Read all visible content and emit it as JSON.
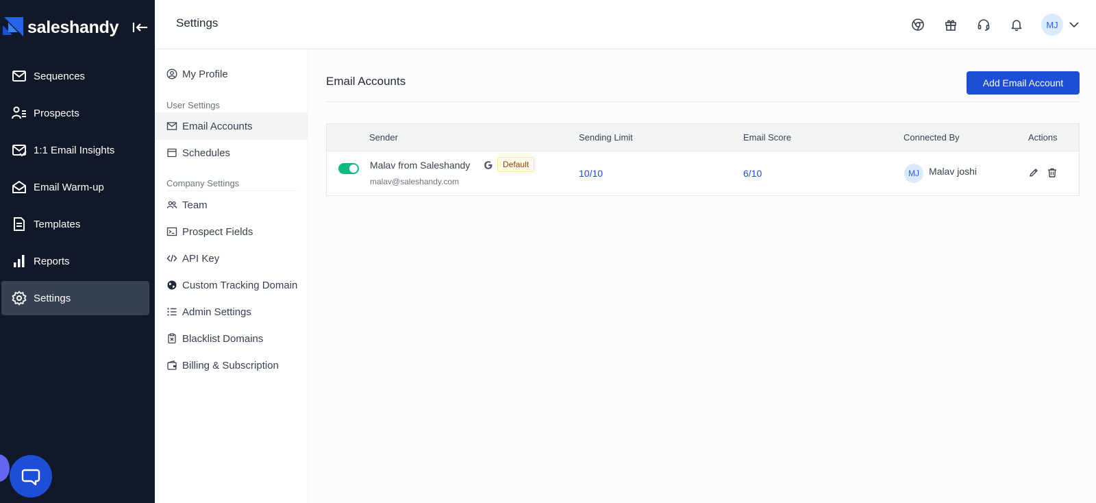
{
  "brand": {
    "name": "saleshandy"
  },
  "nav": {
    "items": [
      {
        "label": "Sequences",
        "icon": "mail-icon",
        "active": false
      },
      {
        "label": "Prospects",
        "icon": "prospects-icon",
        "active": false
      },
      {
        "label": "1:1 Email Insights",
        "icon": "email-insights-icon",
        "active": false
      },
      {
        "label": "Email Warm-up",
        "icon": "open-envelope-icon",
        "active": false
      },
      {
        "label": "Templates",
        "icon": "document-icon",
        "active": false
      },
      {
        "label": "Reports",
        "icon": "bar-chart-icon",
        "active": false
      },
      {
        "label": "Settings",
        "icon": "gear-icon",
        "active": true
      }
    ]
  },
  "header": {
    "title": "Settings",
    "avatar_initials": "MJ"
  },
  "subnav": {
    "my_profile": "My Profile",
    "user_settings_heading": "User Settings",
    "email_accounts": "Email Accounts",
    "schedules": "Schedules",
    "company_settings_heading": "Company Settings",
    "team": "Team",
    "prospect_fields": "Prospect Fields",
    "api_key": "API Key",
    "custom_tracking_domain": "Custom Tracking Domain",
    "admin_settings": "Admin Settings",
    "blacklist_domains": "Blacklist Domains",
    "billing_subscription": "Billing & Subscription"
  },
  "main": {
    "section_title": "Email Accounts",
    "add_button": "Add Email Account",
    "columns": {
      "sender": "Sender",
      "sending_limit": "Sending Limit",
      "email_score": "Email Score",
      "connected_by": "Connected By",
      "actions": "Actions"
    },
    "rows": [
      {
        "active": true,
        "sender_name": "Malav from Saleshandy",
        "badge": "Default",
        "sender_email": "malav@saleshandy.com",
        "sending_limit": "10/10",
        "email_score": "6/10",
        "connected_by_initials": "MJ",
        "connected_by_name": "Malav joshi"
      }
    ]
  },
  "colors": {
    "nav_bg": "#111827",
    "nav_active": "#374151",
    "accent": "#1d4ed8",
    "toggle_on": "#10b981"
  }
}
